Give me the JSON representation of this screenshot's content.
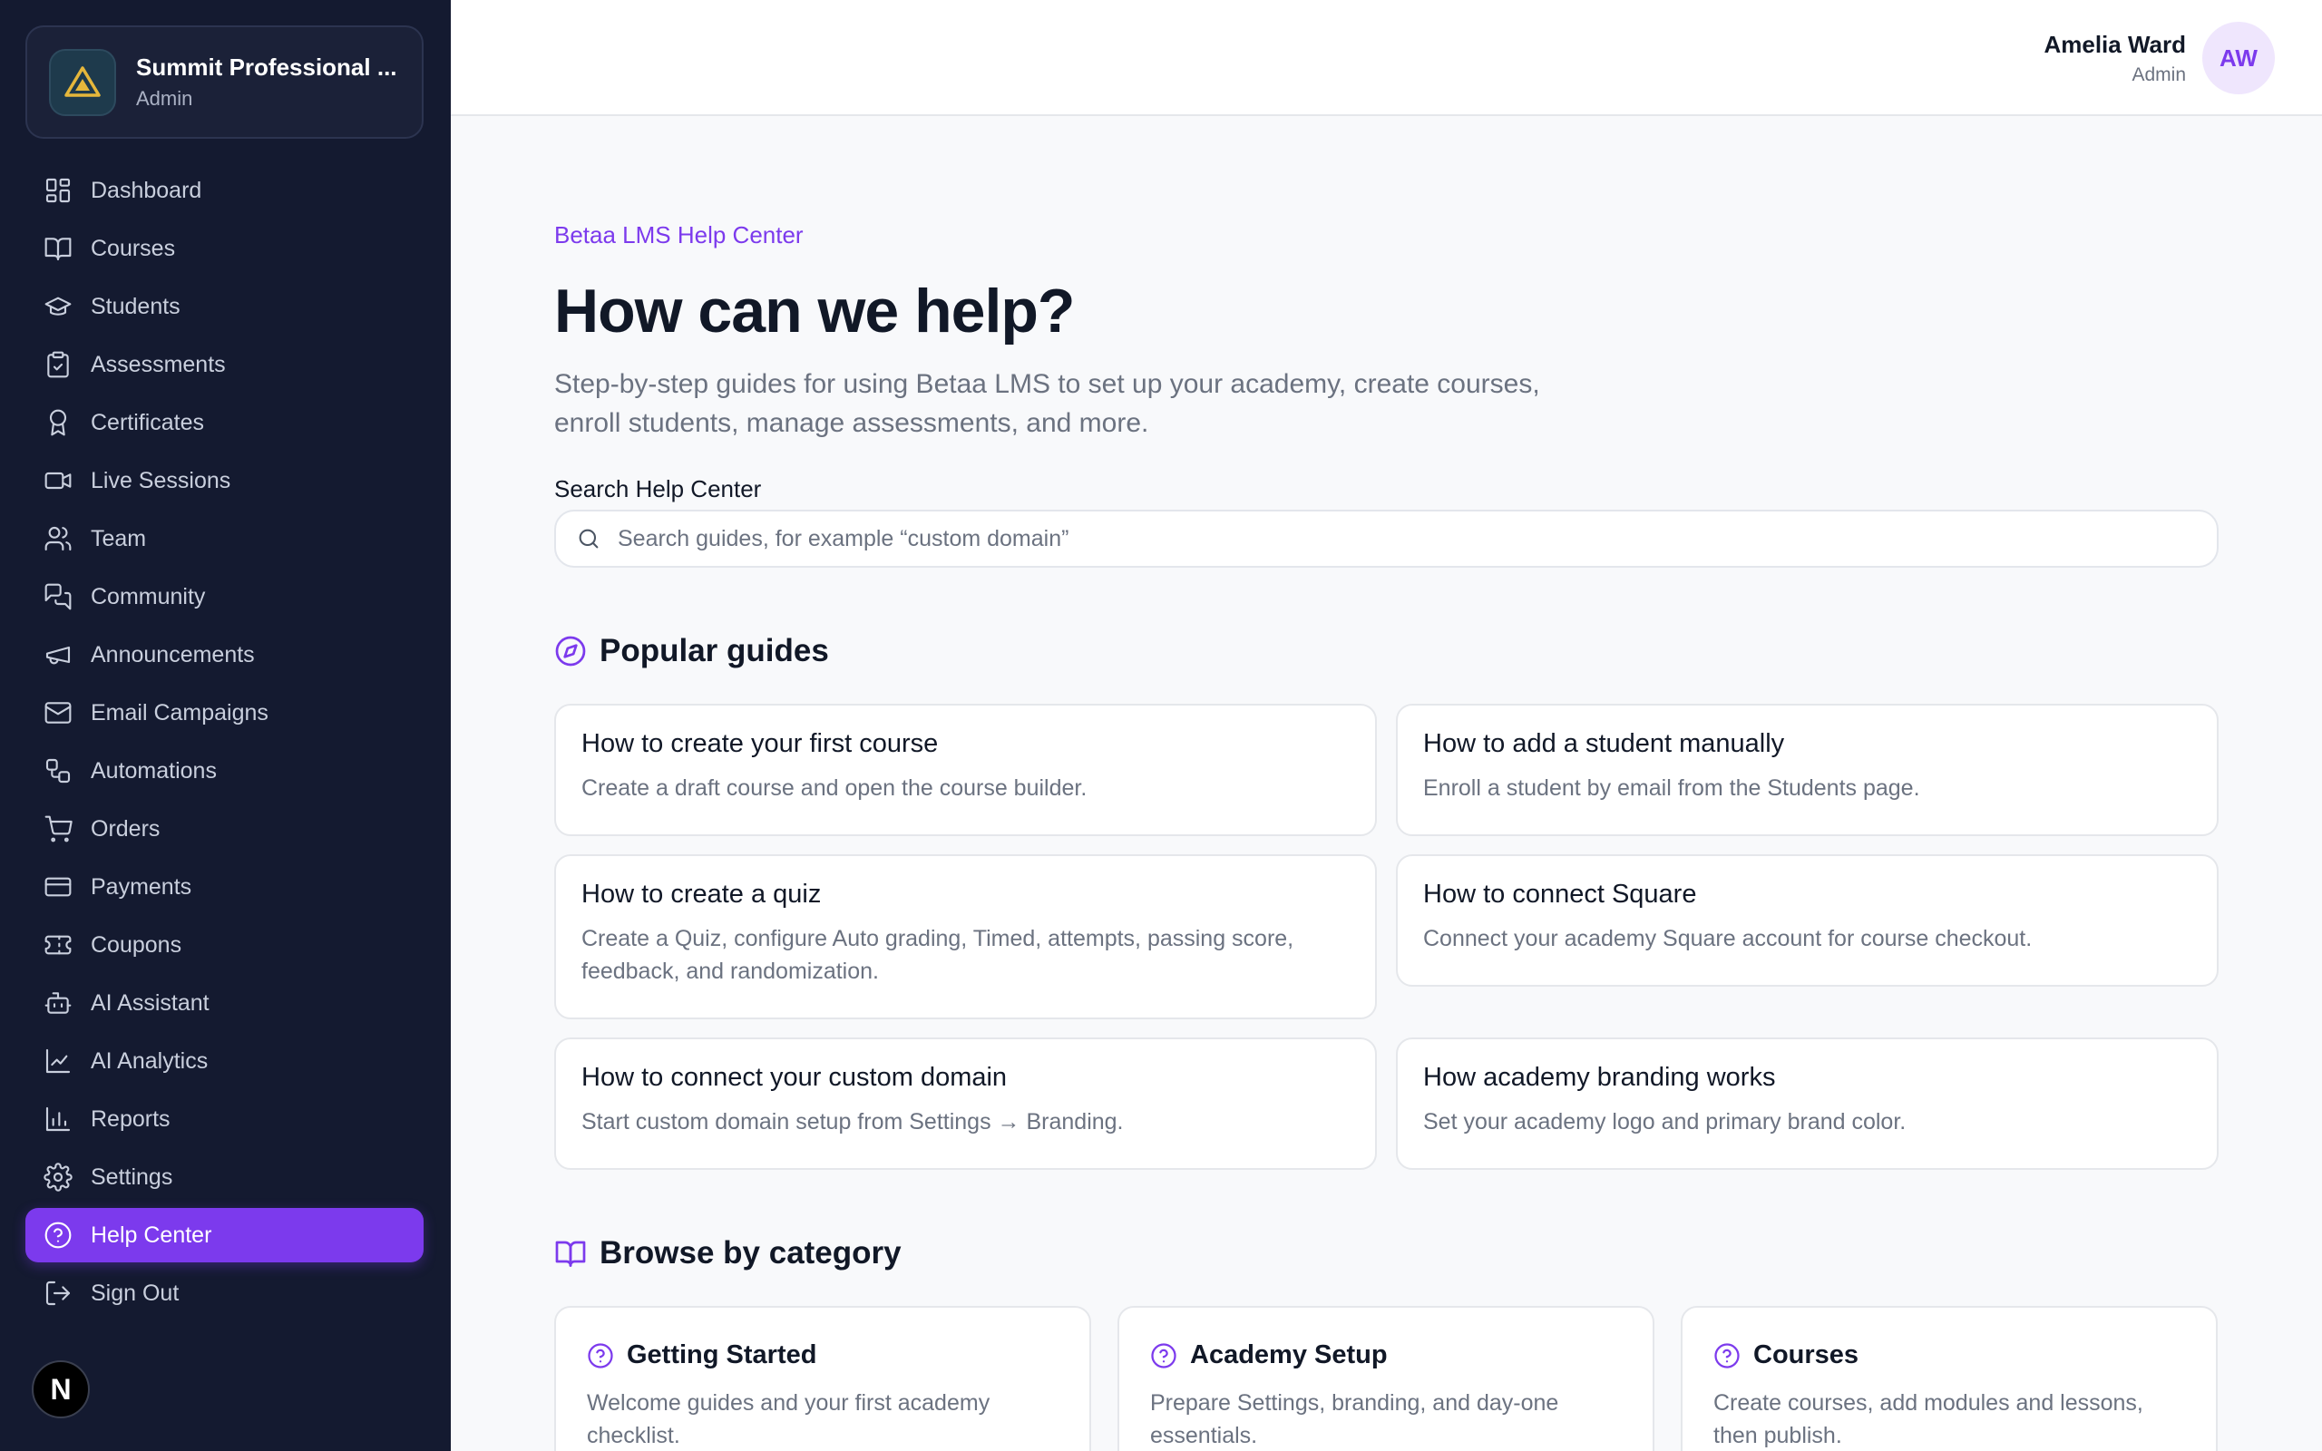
{
  "org": {
    "name": "Summit Professional ...",
    "role": "Admin"
  },
  "nav": [
    {
      "label": "Dashboard",
      "icon": "dashboard-icon"
    },
    {
      "label": "Courses",
      "icon": "book-icon"
    },
    {
      "label": "Students",
      "icon": "graduation-cap-icon"
    },
    {
      "label": "Assessments",
      "icon": "clipboard-check-icon"
    },
    {
      "label": "Certificates",
      "icon": "award-icon"
    },
    {
      "label": "Live Sessions",
      "icon": "video-icon"
    },
    {
      "label": "Team",
      "icon": "users-icon"
    },
    {
      "label": "Community",
      "icon": "chat-icon"
    },
    {
      "label": "Announcements",
      "icon": "megaphone-icon"
    },
    {
      "label": "Email Campaigns",
      "icon": "mail-icon"
    },
    {
      "label": "Automations",
      "icon": "workflow-icon"
    },
    {
      "label": "Orders",
      "icon": "cart-icon"
    },
    {
      "label": "Payments",
      "icon": "credit-card-icon"
    },
    {
      "label": "Coupons",
      "icon": "ticket-icon"
    },
    {
      "label": "AI Assistant",
      "icon": "bot-icon"
    },
    {
      "label": "AI Analytics",
      "icon": "line-chart-icon"
    },
    {
      "label": "Reports",
      "icon": "bar-chart-icon"
    },
    {
      "label": "Settings",
      "icon": "gear-icon"
    },
    {
      "label": "Help Center",
      "icon": "help-circle-icon",
      "active": true
    },
    {
      "label": "Sign Out",
      "icon": "sign-out-icon"
    }
  ],
  "badge": "N",
  "user": {
    "name": "Amelia Ward",
    "role": "Admin",
    "initials": "AW"
  },
  "hero": {
    "eyebrow": "Betaa LMS Help Center",
    "title": "How can we help?",
    "intro": "Step-by-step guides for using Betaa LMS to set up your academy, create courses, enroll students, manage assessments, and more."
  },
  "search": {
    "label": "Search Help Center",
    "placeholder": "Search guides, for example “custom domain”",
    "value": ""
  },
  "popular": {
    "title": "Popular guides",
    "guides": [
      {
        "title": "How to create your first course",
        "desc": "Create a draft course and open the course builder."
      },
      {
        "title": "How to add a student manually",
        "desc": "Enroll a student by email from the Students page."
      },
      {
        "title": "How to create a quiz",
        "desc": "Create a Quiz, configure Auto grading, Timed, attempts, passing score, feedback, and randomization."
      },
      {
        "title": "How to connect Square",
        "desc": "Connect your academy Square account for course checkout."
      },
      {
        "title": "How to connect your custom domain",
        "desc": "Start custom domain setup from Settings → Branding."
      },
      {
        "title": "How academy branding works",
        "desc": "Set your academy logo and primary brand color."
      }
    ]
  },
  "categories": {
    "title": "Browse by category",
    "items": [
      {
        "title": "Getting Started",
        "desc": "Welcome guides and your first academy checklist."
      },
      {
        "title": "Academy Setup",
        "desc": "Prepare Settings, branding, and day-one essentials."
      },
      {
        "title": "Courses",
        "desc": "Create courses, add modules and lessons, then publish."
      }
    ]
  },
  "colors": {
    "accent": "#7c3aed",
    "sidebar": "#141a30",
    "background": "#f8f9fb"
  }
}
